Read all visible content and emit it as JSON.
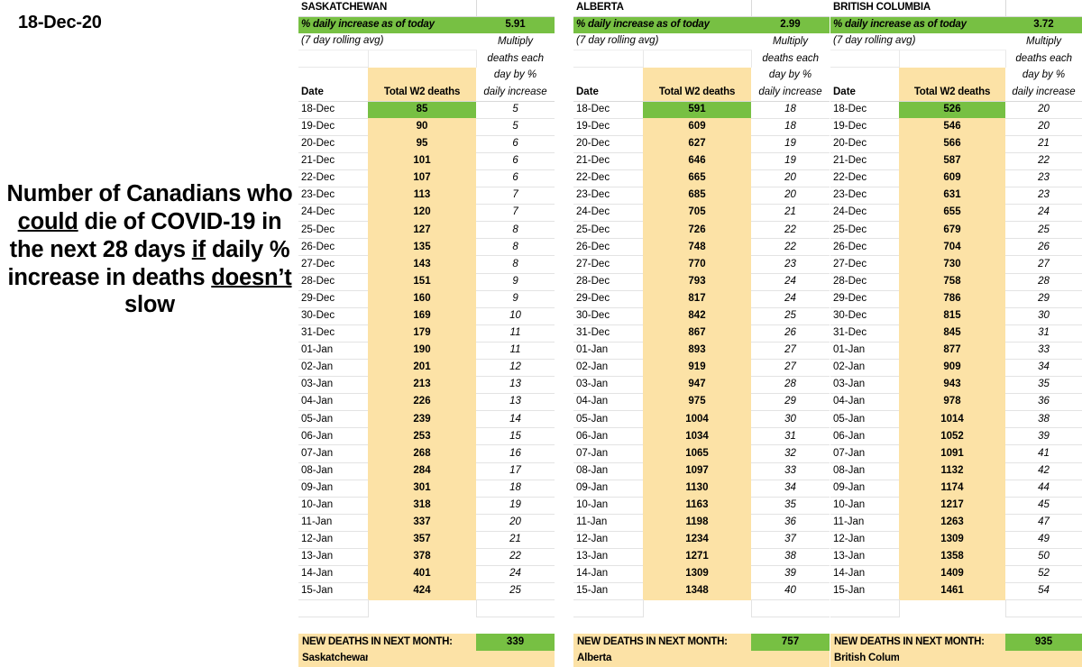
{
  "left": {
    "date_stamp": "18-Dec-20",
    "headline_parts": [
      {
        "text": "Number of Canadians who ",
        "underline": false
      },
      {
        "text": "could",
        "underline": true
      },
      {
        "text": " die of COVID-19 in the next 28 days ",
        "underline": false
      },
      {
        "text": "if",
        "underline": true
      },
      {
        "text": " daily % increase in deaths ",
        "underline": false
      },
      {
        "text": "doesn’t",
        "underline": true
      },
      {
        "text": " slow",
        "underline": false
      }
    ]
  },
  "labels": {
    "pct_label": "% daily increase as of today",
    "rolling_avg": "(7 day rolling avg)",
    "multiply_line1": "Multiply",
    "multiply_line2": "deaths each",
    "multiply_line3": "day by %",
    "multiply_line4": "daily increase",
    "col_date": "Date",
    "col_total": "Total W2 deaths",
    "total_label": "NEW DEATHS IN NEXT MONTH:"
  },
  "colors": {
    "green": "#77C043",
    "tan": "#FCE2A6",
    "text": "#000000",
    "gridline": "#E3E3E3"
  },
  "chart_data": {
    "type": "table",
    "title": "Number of Canadians who could die of COVID-19 in the next 28 days if daily % increase in deaths doesn’t slow",
    "as_of": "18-Dec-20",
    "columns": [
      "Date",
      "Total W2 deaths",
      "Multiply deaths each day by % daily increase"
    ],
    "dates": [
      "18-Dec",
      "19-Dec",
      "20-Dec",
      "21-Dec",
      "22-Dec",
      "23-Dec",
      "24-Dec",
      "25-Dec",
      "26-Dec",
      "27-Dec",
      "28-Dec",
      "29-Dec",
      "30-Dec",
      "31-Dec",
      "01-Jan",
      "02-Jan",
      "03-Jan",
      "04-Jan",
      "05-Jan",
      "06-Jan",
      "07-Jan",
      "08-Jan",
      "09-Jan",
      "10-Jan",
      "11-Jan",
      "12-Jan",
      "13-Jan",
      "14-Jan",
      "15-Jan"
    ],
    "series": [
      {
        "name": "SASKATCHEWAN",
        "pct_daily_increase": "5.91",
        "new_deaths_next_month": "339",
        "footer_name": "Saskatchewan",
        "totals": [
          85,
          90,
          95,
          101,
          107,
          113,
          120,
          127,
          135,
          143,
          151,
          160,
          169,
          179,
          190,
          201,
          213,
          226,
          239,
          253,
          268,
          284,
          301,
          318,
          337,
          357,
          378,
          401,
          424
        ],
        "daily_increase": [
          5,
          5,
          6,
          6,
          6,
          7,
          7,
          8,
          8,
          8,
          9,
          9,
          10,
          11,
          11,
          12,
          13,
          13,
          14,
          15,
          16,
          17,
          18,
          19,
          20,
          21,
          22,
          24,
          25
        ]
      },
      {
        "name": "ALBERTA",
        "pct_daily_increase": "2.99",
        "new_deaths_next_month": "757",
        "footer_name": "Alberta",
        "totals": [
          591,
          609,
          627,
          646,
          665,
          685,
          705,
          726,
          748,
          770,
          793,
          817,
          842,
          867,
          893,
          919,
          947,
          975,
          1004,
          1034,
          1065,
          1097,
          1130,
          1163,
          1198,
          1234,
          1271,
          1309,
          1348
        ],
        "daily_increase": [
          18,
          18,
          19,
          19,
          20,
          20,
          21,
          22,
          22,
          23,
          24,
          24,
          25,
          26,
          27,
          27,
          28,
          29,
          30,
          31,
          32,
          33,
          34,
          35,
          36,
          37,
          38,
          39,
          40
        ]
      },
      {
        "name": "BRITISH COLUMBIA",
        "pct_daily_increase": "3.72",
        "new_deaths_next_month": "935",
        "footer_name": "British Columbia",
        "totals": [
          526,
          546,
          566,
          587,
          609,
          631,
          655,
          679,
          704,
          730,
          758,
          786,
          815,
          845,
          877,
          909,
          943,
          978,
          1014,
          1052,
          1091,
          1132,
          1174,
          1217,
          1263,
          1309,
          1358,
          1409,
          1461
        ],
        "daily_increase": [
          20,
          20,
          21,
          22,
          23,
          23,
          24,
          25,
          26,
          27,
          28,
          29,
          30,
          31,
          33,
          34,
          35,
          36,
          38,
          39,
          41,
          42,
          44,
          45,
          47,
          49,
          50,
          52,
          54
        ]
      }
    ]
  }
}
